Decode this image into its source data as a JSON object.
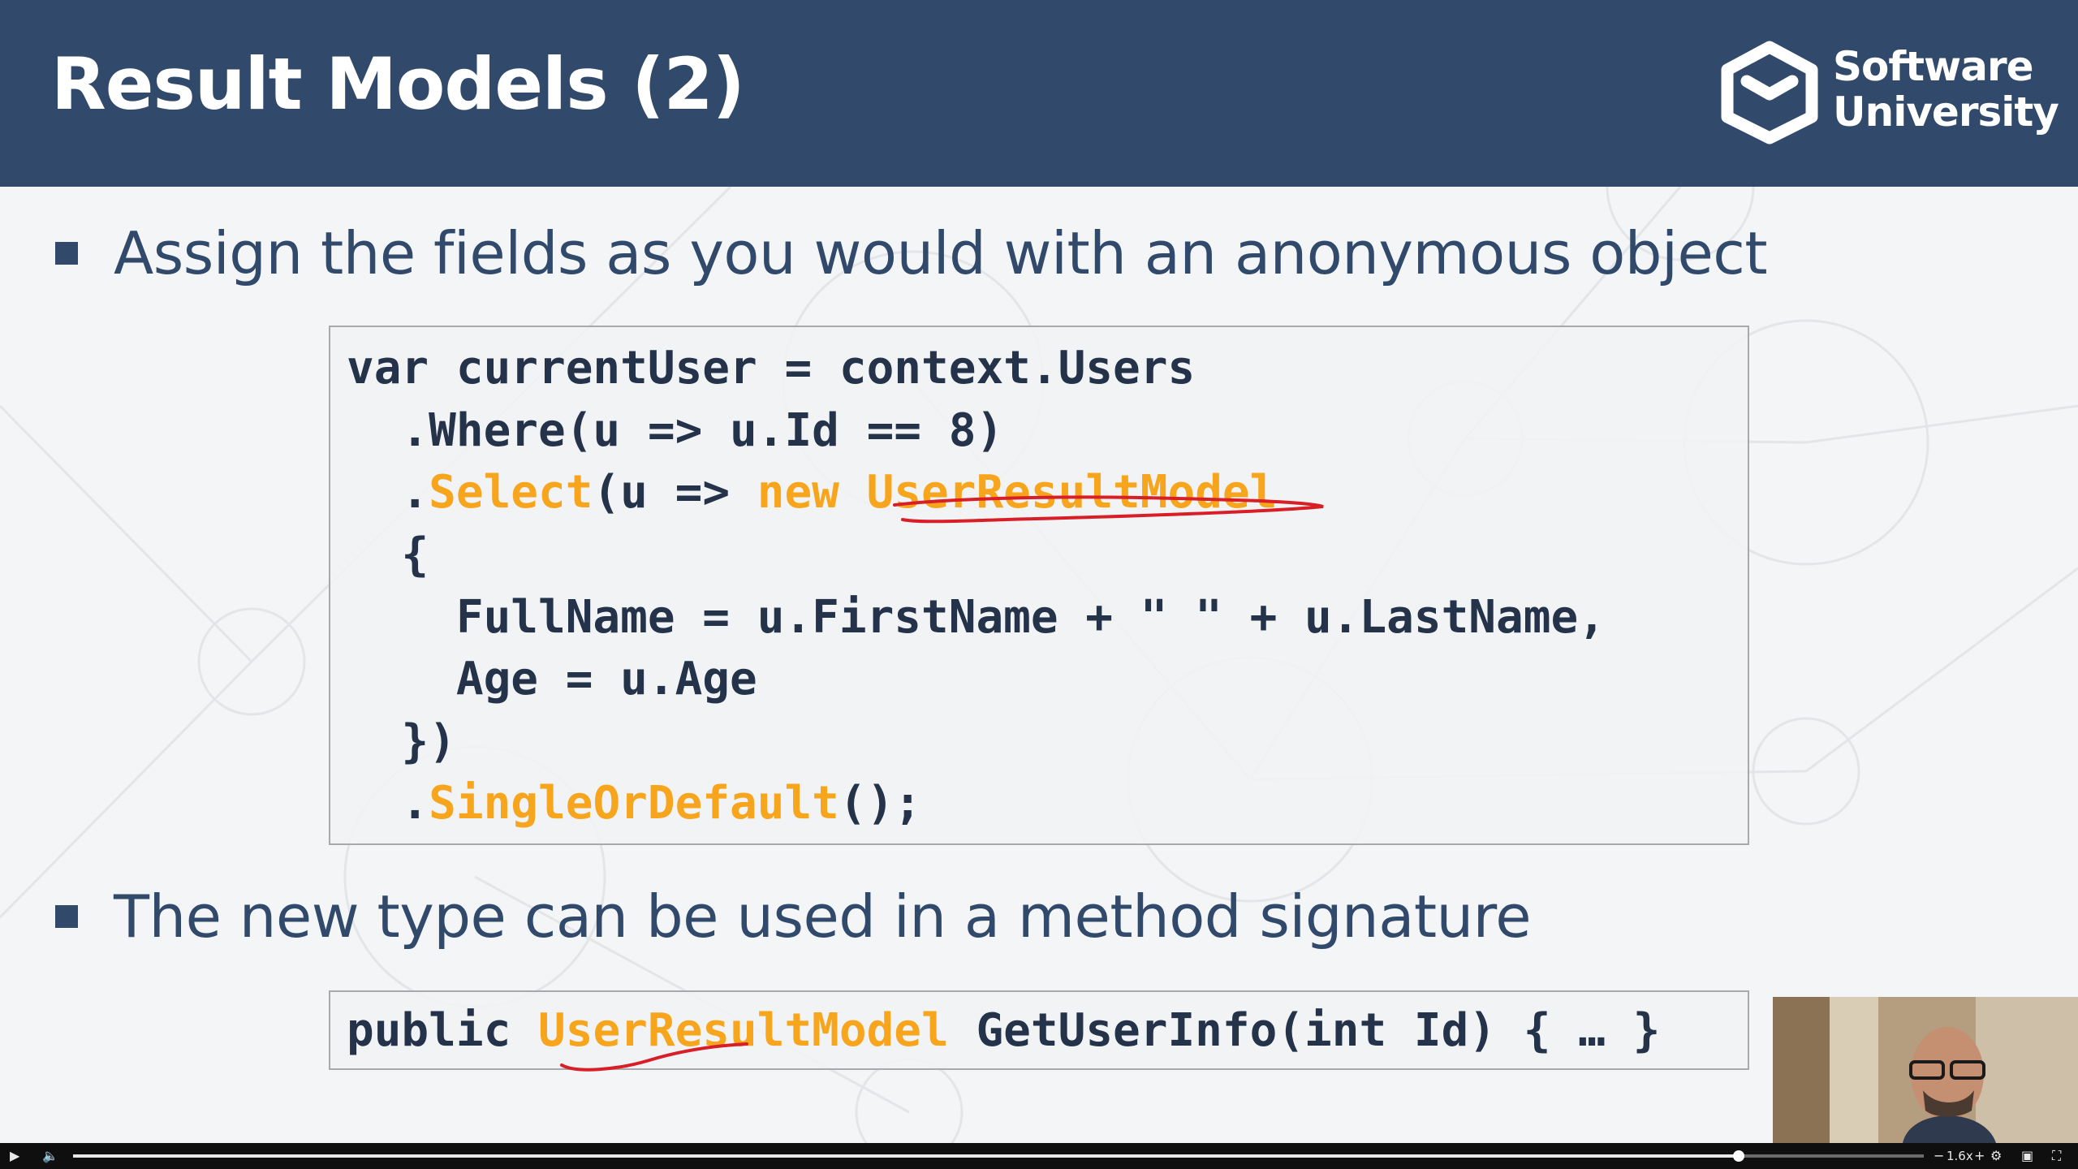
{
  "slide": {
    "title": "Result Models (2)",
    "logo": {
      "line1": "Software",
      "line2": "University"
    },
    "bullets": [
      "Assign the fields as you would with an anonymous object",
      "The new type can be used in a method signature"
    ],
    "code_block_1": {
      "lines": [
        {
          "plain1": "var currentUser = context.Users"
        },
        {
          "plain1": "  .Where(u => u.Id == 8)"
        },
        {
          "plain1": "  .",
          "kw1": "Select",
          "plain2": "(u => ",
          "kw2": "new UserResultModel"
        },
        {
          "plain1": "  {"
        },
        {
          "plain1": "    FullName = u.FirstName + \" \" + u.LastName,"
        },
        {
          "plain1": "    Age = u.Age"
        },
        {
          "plain1": "  })"
        },
        {
          "plain1": "  .",
          "kw1": "SingleOrDefault",
          "plain2": "();"
        }
      ]
    },
    "code_block_2": {
      "plain1": "public ",
      "kw1": "UserResultModel",
      "plain2": " GetUserInfo(int Id) { … }"
    }
  },
  "player": {
    "speed_label": "1.6x",
    "progress": 0.9,
    "volume": 0.5
  },
  "colors": {
    "header": "#314a6b",
    "text": "#314a6b",
    "code_keyword": "#f7a51c",
    "annotation": "#d81f27"
  }
}
